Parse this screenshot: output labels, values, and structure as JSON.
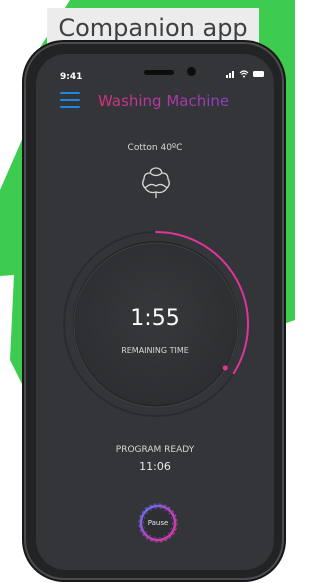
{
  "header_label": "Companion app",
  "status_bar": {
    "time": "9:41"
  },
  "app": {
    "title": "Washing Machine"
  },
  "program": {
    "name": "Cotton 40ºC",
    "icon": "cotton-icon"
  },
  "timer": {
    "remaining": "1:55",
    "label": "REMAINING TIME",
    "progress": 0.34
  },
  "status": {
    "text": "PROGRAM READY",
    "time": "11:06"
  },
  "controls": {
    "pause_label": "Pause"
  },
  "colors": {
    "background_green": "#3dcc4f",
    "accent_pink": "#e0359b",
    "accent_blue": "#1e88e5",
    "screen_bg": "#333538"
  }
}
